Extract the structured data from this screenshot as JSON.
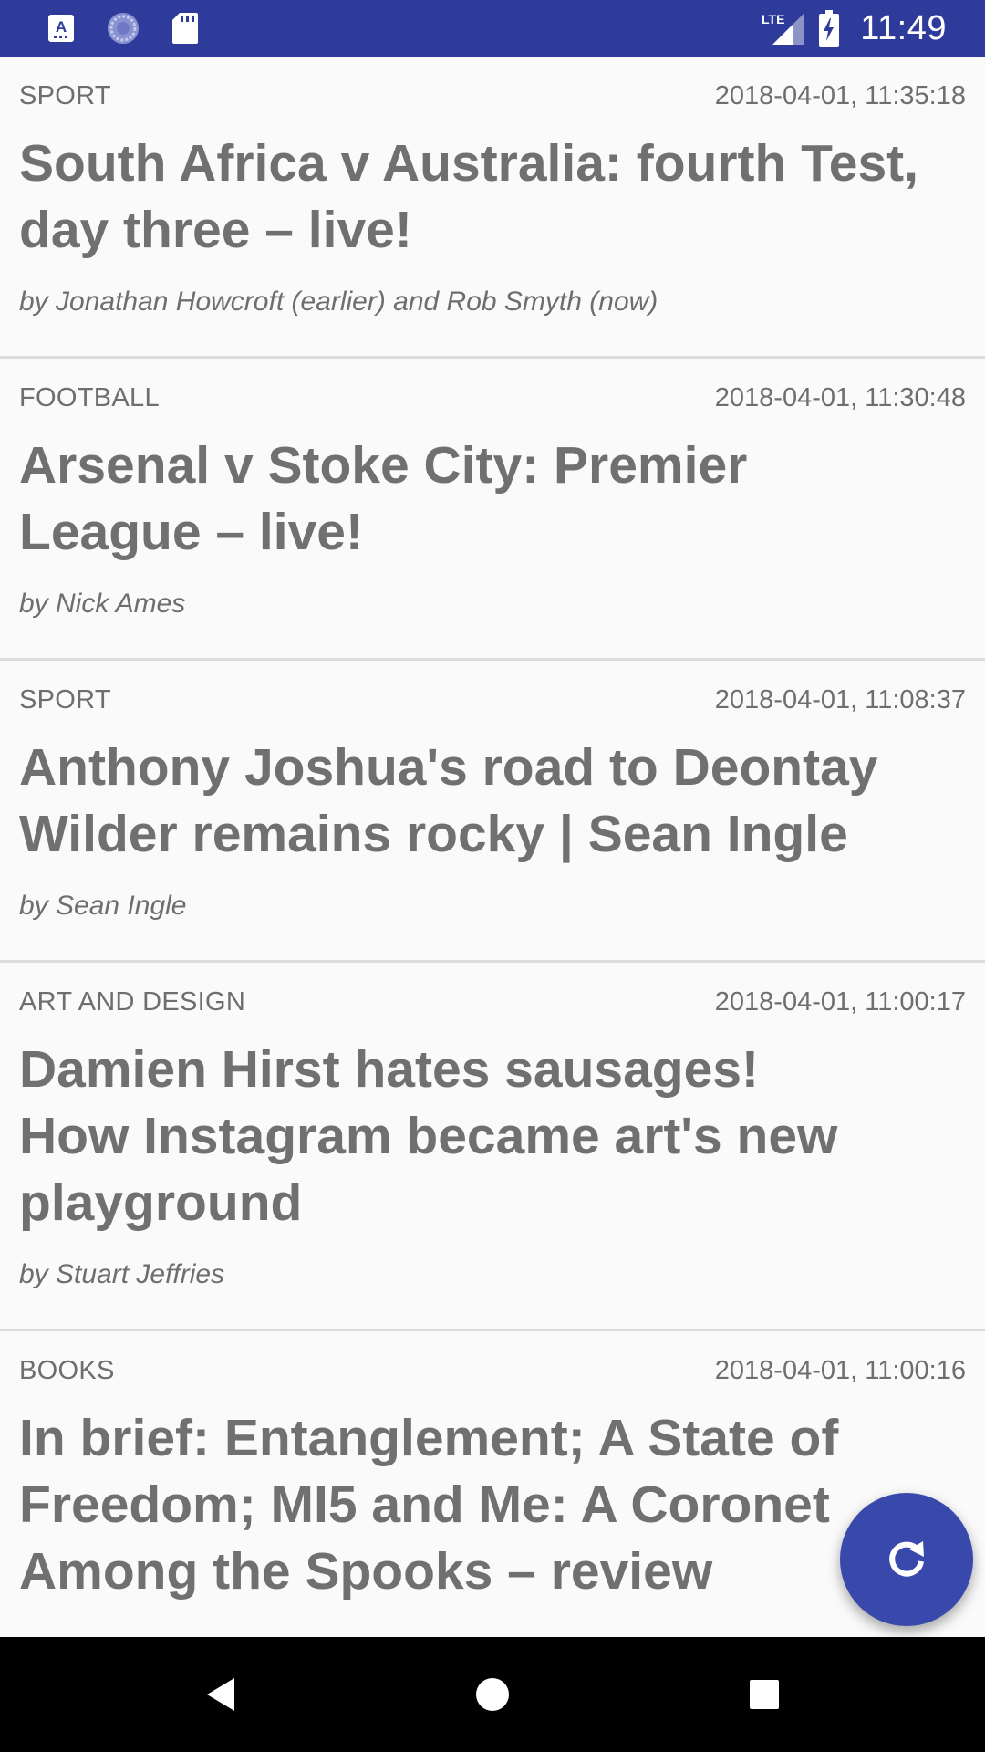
{
  "colors": {
    "status_bar": "#2f3b9a",
    "accent": "#3949ab",
    "text": "#707070",
    "background": "#fafafa"
  },
  "status_bar": {
    "time": "11:49",
    "network": "LTE",
    "left_icons": [
      "keyboard-icon",
      "sync-icon",
      "sd-card-icon"
    ],
    "right_icons": [
      "lte-signal-icon",
      "battery-charging-icon"
    ]
  },
  "articles": [
    {
      "section": "SPORT",
      "timestamp": "2018-04-01, 11:35:18",
      "headline": "South Africa v Australia: fourth Test,\nday three – live!",
      "byline": "by Jonathan Howcroft (earlier) and Rob Smyth (now)"
    },
    {
      "section": "FOOTBALL",
      "timestamp": "2018-04-01, 11:30:48",
      "headline": "Arsenal v Stoke City: Premier\nLeague – live!",
      "byline": "by Nick Ames"
    },
    {
      "section": "SPORT",
      "timestamp": "2018-04-01, 11:08:37",
      "headline": "Anthony Joshua's road to Deontay\nWilder remains rocky | Sean Ingle",
      "byline": "by Sean Ingle"
    },
    {
      "section": "ART AND DESIGN",
      "timestamp": "2018-04-01, 11:00:17",
      "headline": "Damien Hirst hates sausages!\nHow Instagram became art's new\nplayground",
      "byline": "by Stuart Jeffries"
    },
    {
      "section": "BOOKS",
      "timestamp": "2018-04-01, 11:00:16",
      "headline": "In brief: Entanglement; A State of\nFreedom; MI5 and Me: A Coronet\nAmong the Spooks – review",
      "byline": ""
    }
  ],
  "fab": {
    "icon": "refresh-icon"
  },
  "nav_bar": {
    "icons": [
      "back-icon",
      "home-icon",
      "recents-icon"
    ]
  }
}
